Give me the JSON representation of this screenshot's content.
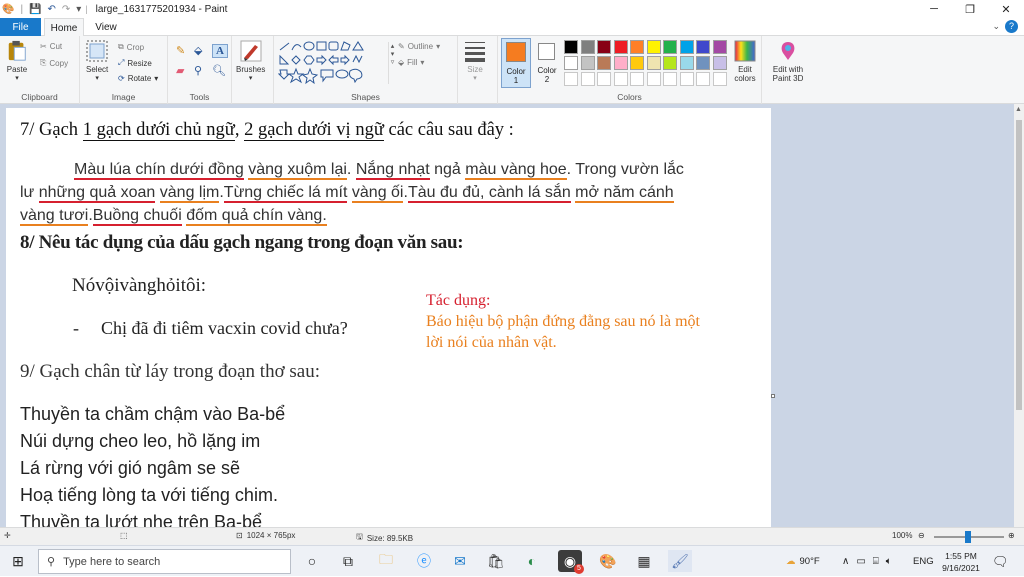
{
  "window": {
    "title": "large_1631775201934 - Paint",
    "controls": {
      "minimize": "─",
      "maximize": "❐",
      "close": "✕"
    }
  },
  "tabs": {
    "file": "File",
    "home": "Home",
    "view": "View"
  },
  "ribbon": {
    "clipboard": {
      "label": "Clipboard",
      "paste": "Paste",
      "cut": "Cut",
      "copy": "Copy"
    },
    "image": {
      "label": "Image",
      "select": "Select",
      "crop": "Crop",
      "resize": "Resize",
      "rotate": "Rotate"
    },
    "tools": {
      "label": "Tools"
    },
    "brushes": {
      "label": "Brushes"
    },
    "shapes": {
      "label": "Shapes",
      "outline": "Outline",
      "fill": "Fill"
    },
    "size": {
      "label": "Size"
    },
    "colors": {
      "label": "Colors",
      "color1_label": "Color",
      "color1_num": "1",
      "color2_label": "Color",
      "color2_num": "2",
      "edit_colors_line1": "Edit",
      "edit_colors_line2": "colors",
      "paint3d_line1": "Edit with",
      "paint3d_line2": "Paint 3D",
      "color1": "#f57c20",
      "color2": "#ffffff",
      "palette_row1": [
        "#000000",
        "#7f7f7f",
        "#880015",
        "#ed1c24",
        "#ff7f27",
        "#fff200",
        "#22b14c",
        "#00a2e8",
        "#3f48cc",
        "#a349a4"
      ],
      "palette_row2": [
        "#ffffff",
        "#c3c3c3",
        "#b97a57",
        "#ffaec9",
        "#ffc90e",
        "#efe4b0",
        "#b5e61d",
        "#99d9ea",
        "#7092be",
        "#c8bfe7"
      ]
    }
  },
  "document": {
    "q7_prefix": "7/ Gạch ",
    "q7_u1": "1 gạch dưới chủ ngữ",
    "q7_sep": ", ",
    "q7_u2": "2 gạch dưới vị ngữ",
    "q7_suffix": " các câu sau đây :",
    "p1": [
      {
        "t": "Màu lúa chín dưới đồng",
        "u": "red"
      },
      {
        "t": " ",
        "u": ""
      },
      {
        "t": "vàng xuộm lại",
        "u": "orange"
      },
      {
        "t": ". ",
        "u": ""
      },
      {
        "t": "Nắng nhạt",
        "u": "red"
      },
      {
        "t": " ngả ",
        "u": ""
      },
      {
        "t": "màu vàng hoe",
        "u": "orange"
      },
      {
        "t": ". Trong vườn lắc",
        "u": ""
      }
    ],
    "p2": [
      {
        "t": "lư ",
        "u": ""
      },
      {
        "t": "những quả xoan",
        "u": "red"
      },
      {
        "t": " ",
        "u": ""
      },
      {
        "t": "vàng lịm",
        "u": "orange"
      },
      {
        "t": ".",
        "u": ""
      },
      {
        "t": "Từng chiếc lá mít",
        "u": "red"
      },
      {
        "t": " ",
        "u": ""
      },
      {
        "t": "vàng ối",
        "u": "orange"
      },
      {
        "t": ".",
        "u": ""
      },
      {
        "t": "Tàu đu đủ, cành lá sắn",
        "u": "red"
      },
      {
        "t": " ",
        "u": ""
      },
      {
        "t": "mở năm cánh",
        "u": "orange"
      }
    ],
    "p3": [
      {
        "t": "vàng tươi",
        "u": "orange"
      },
      {
        "t": ".",
        "u": ""
      },
      {
        "t": "Buồng chuối",
        "u": "red"
      },
      {
        "t": " ",
        "u": ""
      },
      {
        "t": "đốm quả chín vàng.",
        "u": "orange"
      }
    ],
    "q8": "8/ Nêu tác dụng của dấu gạch ngang trong đoạn văn sau:",
    "q8_line1": "Nóvộivànghỏitôi:",
    "q8_dash": "-",
    "q8_line2": "Chị đã đi tiêm vacxin covid chưa?",
    "tacdung_title": "Tác dụng:",
    "tacdung_l1": "Báo hiệu bộ phận đứng đằng sau nó là một",
    "tacdung_l2": "lời nói của nhân vật.",
    "q9": "9/ Gạch chân từ láy trong đoạn thơ sau:",
    "poem": [
      "Thuyền ta chầm chậm vào Ba-bể",
      "Núi dựng cheo leo, hồ lặng im",
      "Lá rừng với gió ngâm se sẽ",
      "Hoạ tiếng lòng ta với tiếng chim.",
      "Thuyền ta lướt nhẹ trên Ba-bể"
    ]
  },
  "status": {
    "dimensions": "1024 × 765px",
    "size": "Size: 89.5KB",
    "zoom": "100%"
  },
  "taskbar": {
    "search_placeholder": "Type here to search",
    "weather": "90°F",
    "lang": "ENG",
    "time": "1:55 PM",
    "date": "9/16/2021",
    "badge": "5"
  }
}
